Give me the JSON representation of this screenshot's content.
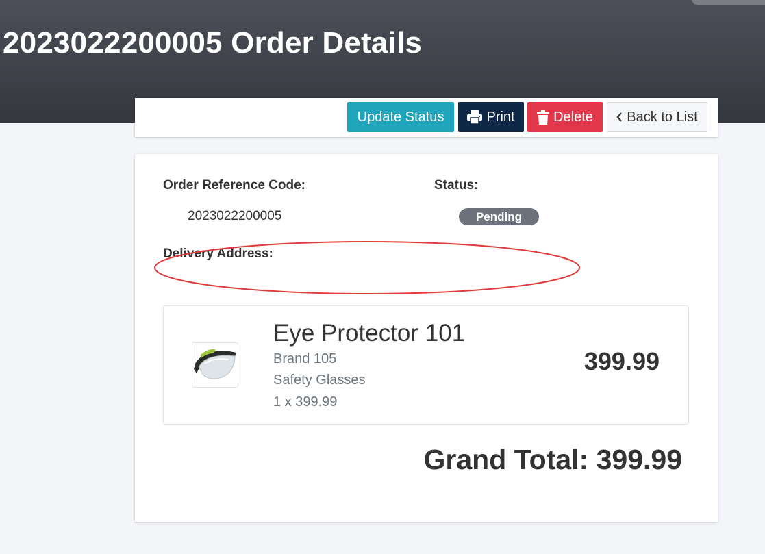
{
  "header": {
    "title": "2023022200005 Order Details"
  },
  "toolbar": {
    "update_status_label": "Update Status",
    "print_label": "Print",
    "delete_label": "Delete",
    "back_label": "Back to List"
  },
  "order": {
    "reference_label": "Order Reference Code:",
    "reference_value": "2023022200005",
    "status_label": "Status:",
    "status_value": "Pending",
    "delivery_label": "Delivery Address:",
    "delivery_value": ""
  },
  "items": [
    {
      "name": "Eye Protector 101",
      "brand": "Brand 105",
      "category": "Safety Glasses",
      "quantity_line": "1 x 399.99",
      "total": "399.99"
    }
  ],
  "grand_total": "Grand Total: 399.99",
  "colors": {
    "header_bg": "#3a3d44",
    "page_bg": "#f3f5f9",
    "update_button": "#1fa6bc",
    "print_button": "#0f2847",
    "delete_button": "#e2374a",
    "status_badge": "#6c727b",
    "annotation": "#e03a3a"
  },
  "icons": {
    "print": "printer-icon",
    "delete": "trash-icon",
    "back": "chevron-left-icon"
  }
}
